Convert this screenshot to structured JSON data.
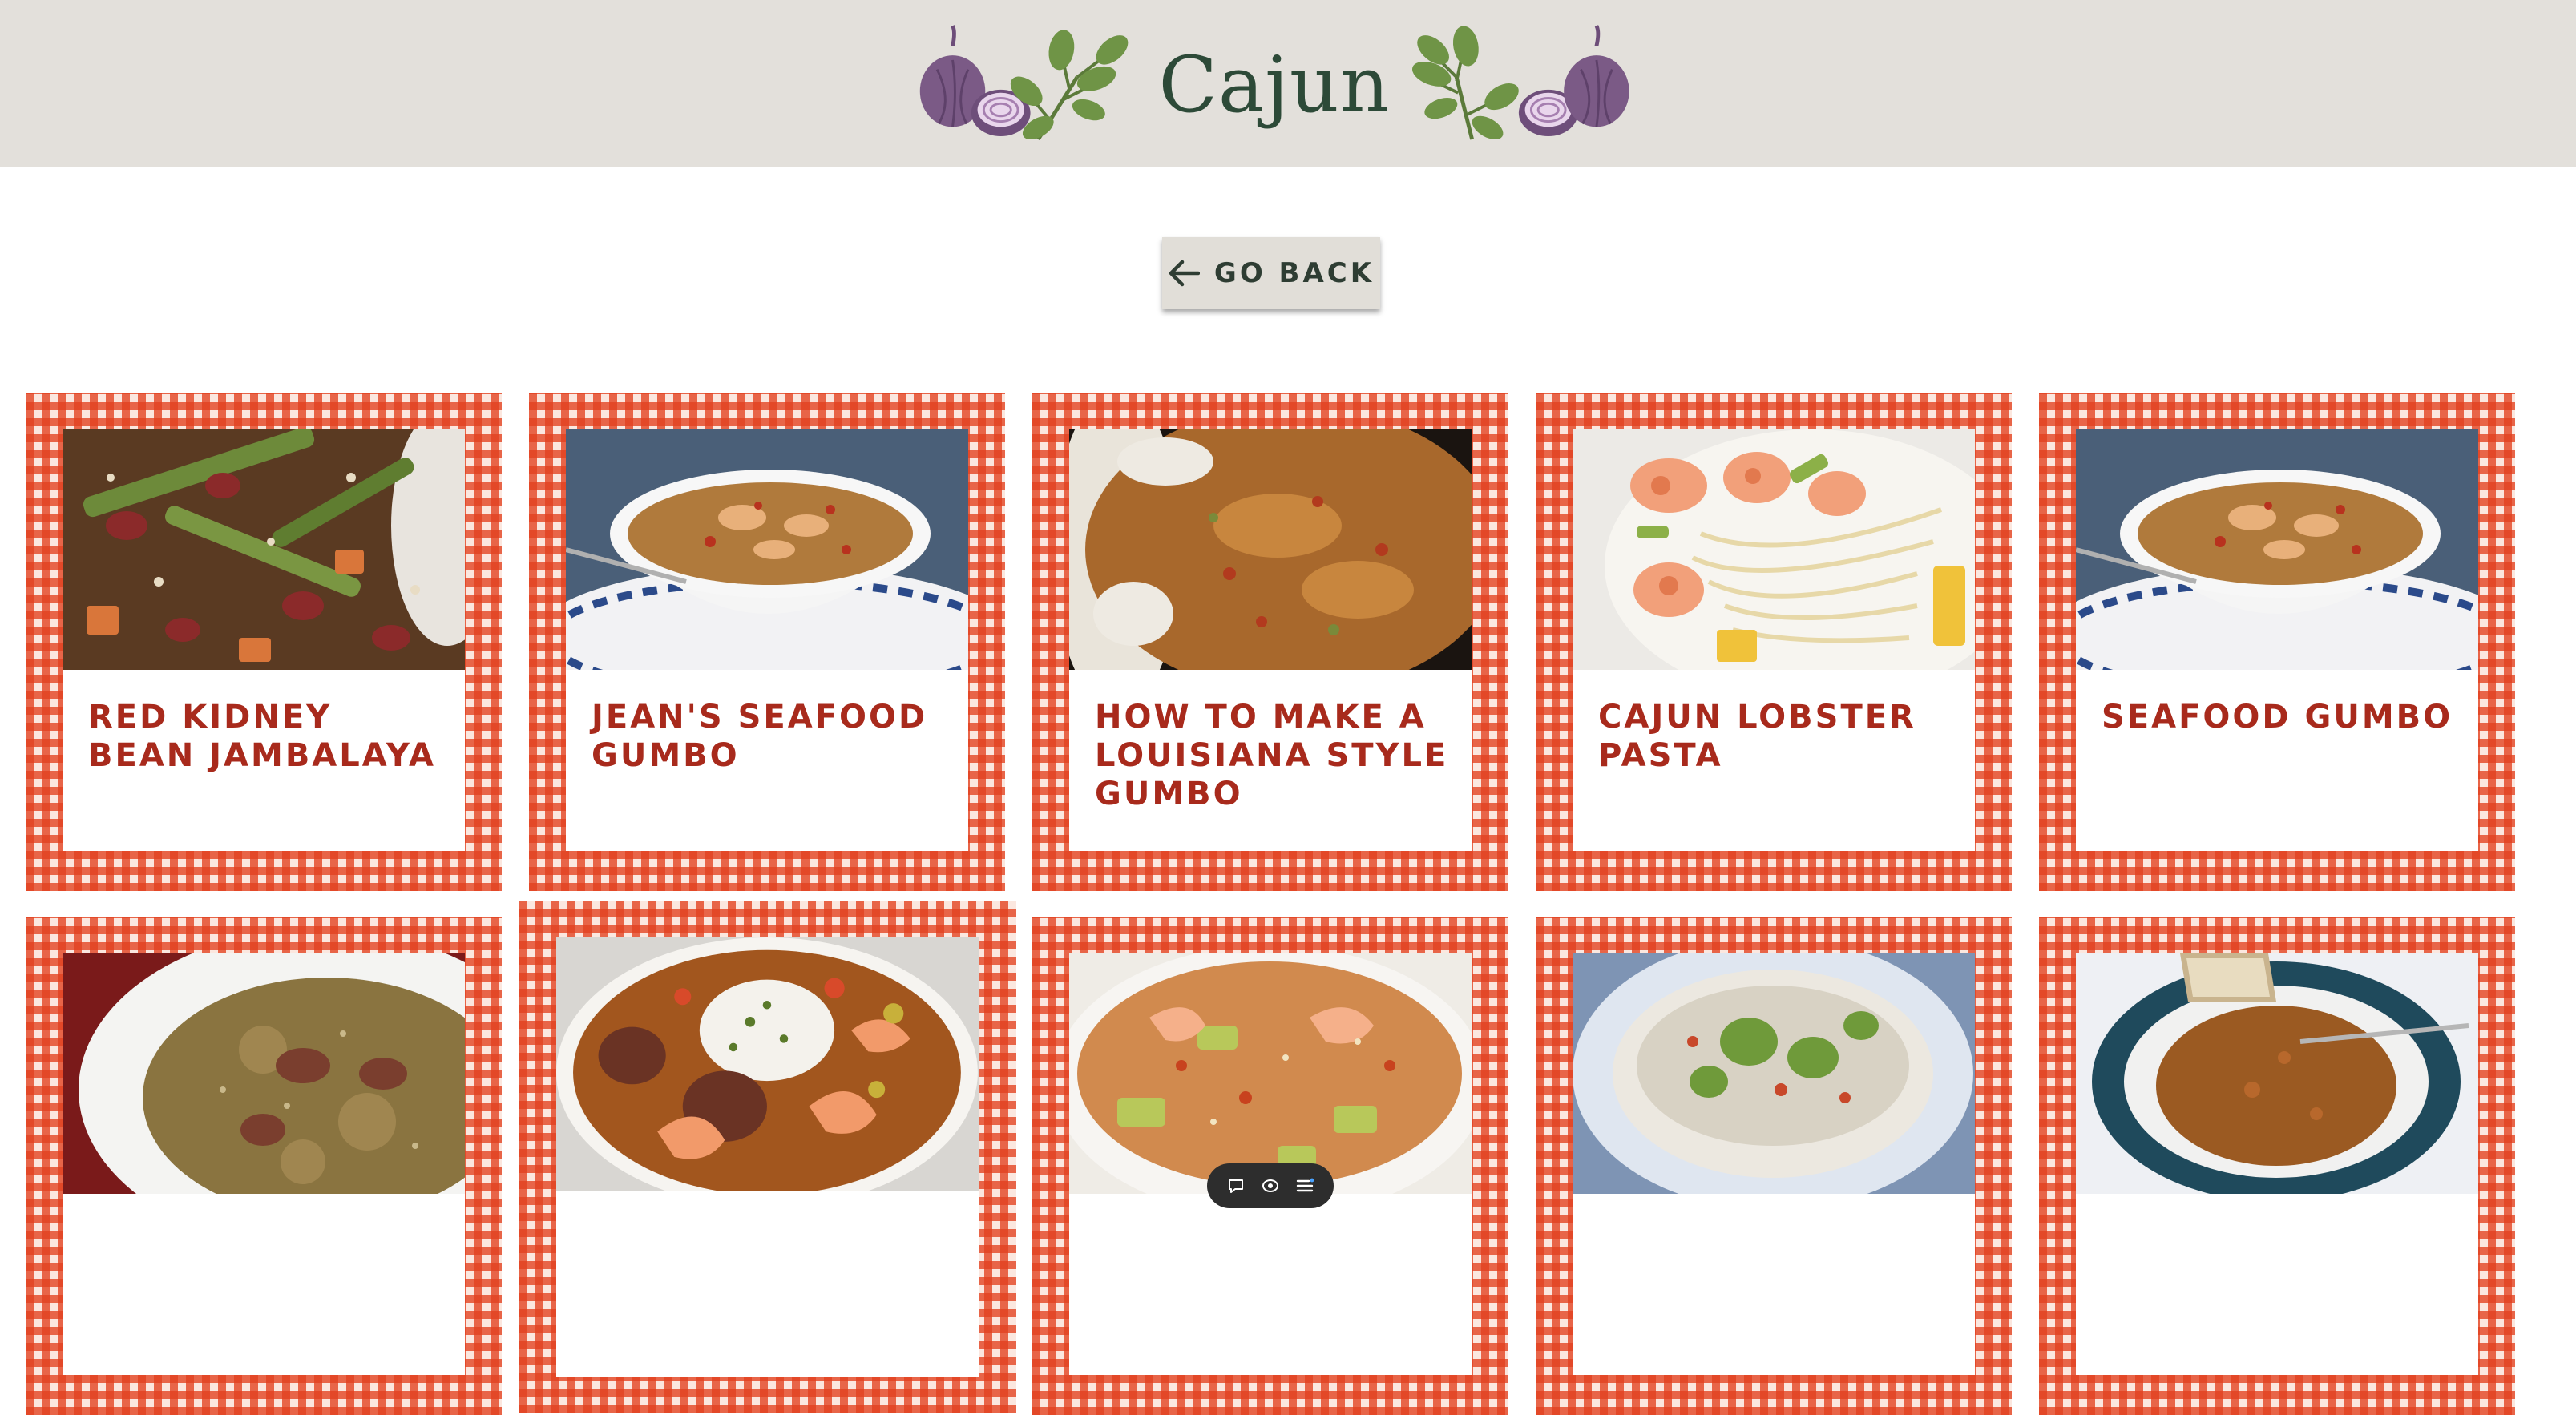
{
  "header": {
    "title": "Cajun",
    "decor_left": "onion-and-parsley-illustration",
    "decor_right": "parsley-and-onion-illustration"
  },
  "back_button": {
    "label": "GO BACK",
    "icon": "arrow-left-icon"
  },
  "recipes": [
    {
      "name": "RED KIDNEY BEAN JAMBALAYA",
      "photo": "jambalaya"
    },
    {
      "name": "JEAN'S SEAFOOD GUMBO",
      "photo": "gumbo-bowl"
    },
    {
      "name": "HOW TO MAKE A LOUISIANA STYLE GUMBO",
      "photo": "gumbo-closeup"
    },
    {
      "name": "CAJUN LOBSTER PASTA",
      "photo": "lobster-pasta"
    },
    {
      "name": "SEAFOOD GUMBO",
      "photo": "gumbo-bowl"
    },
    {
      "name": "",
      "photo": "dirty-rice"
    },
    {
      "name": "",
      "photo": "shrimp-sausage-stew"
    },
    {
      "name": "",
      "photo": "shrimp-jambalaya"
    },
    {
      "name": "",
      "photo": "rice-vegetable-bowl"
    },
    {
      "name": "",
      "photo": "soup-with-bread"
    }
  ],
  "toolbar": {
    "icons": [
      "comment-icon",
      "eye-icon",
      "list-icon"
    ]
  },
  "colors": {
    "header_bg": "#e3e0db",
    "title": "#2d4a38",
    "gingham": "#e2401e",
    "recipe_name": "#a82a1c",
    "button_bg": "#e1ded8"
  }
}
